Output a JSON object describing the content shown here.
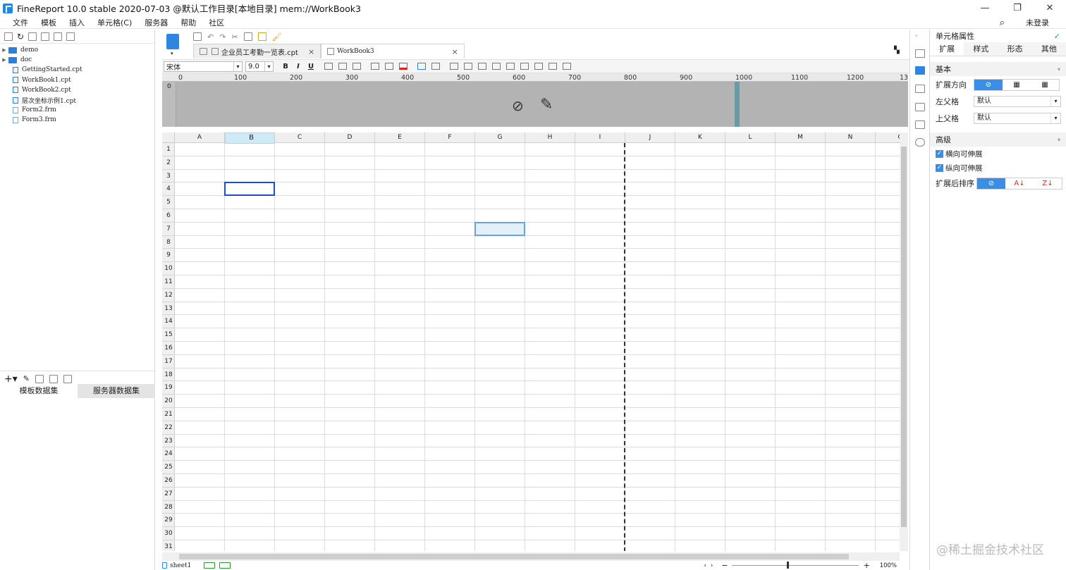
{
  "window": {
    "title": "FineReport 10.0 stable 2020-07-03 @默认工作目录[本地目录]    mem://WorkBook3",
    "minimize_icon": "minimize-icon",
    "restore_icon": "restore-icon",
    "close_icon": "close-icon"
  },
  "menu": {
    "items": [
      "文件",
      "模板",
      "插入",
      "单元格(C)",
      "服务器",
      "帮助",
      "社区"
    ],
    "login": "未登录"
  },
  "tree": {
    "items": [
      {
        "name": "demo",
        "type": "folder"
      },
      {
        "name": "doc",
        "type": "folder"
      },
      {
        "name": "GettingStarted.cpt",
        "type": "cpt"
      },
      {
        "name": "WorkBook1.cpt",
        "type": "cpt"
      },
      {
        "name": "WorkBook2.cpt",
        "type": "cpt"
      },
      {
        "name": "层次坐标示例1.cpt",
        "type": "cpt"
      },
      {
        "name": "Form2.frm",
        "type": "frm"
      },
      {
        "name": "Form3.frm",
        "type": "frm"
      }
    ]
  },
  "datasets": {
    "tab_template": "模板数据集",
    "tab_server": "服务器数据集"
  },
  "tabs": [
    {
      "label": "企业员工考勤一览表.cpt",
      "close": "×"
    },
    {
      "label": "WorkBook3",
      "close": "×"
    }
  ],
  "format": {
    "font": "宋体",
    "size": "9.0",
    "bold": "B",
    "italic": "I",
    "underline": "U"
  },
  "ruler": {
    "labels": [
      "0",
      "100",
      "200",
      "300",
      "400",
      "500",
      "600",
      "700",
      "800",
      "900",
      "1000",
      "1100",
      "1200",
      "13"
    ]
  },
  "grid": {
    "columns": [
      "A",
      "B",
      "C",
      "D",
      "E",
      "F",
      "G",
      "H",
      "I",
      "J",
      "K",
      "L",
      "M",
      "N",
      "O"
    ],
    "rows": [
      "1",
      "2",
      "3",
      "4",
      "5",
      "6",
      "7",
      "8",
      "9",
      "10",
      "11",
      "12",
      "13",
      "14",
      "15",
      "16",
      "17",
      "18",
      "19",
      "20",
      "21",
      "22",
      "23",
      "24",
      "25",
      "26",
      "27",
      "28",
      "29",
      "30",
      "31"
    ],
    "selected_column": "B"
  },
  "status": {
    "sheet": "sheet1",
    "zoom": "100%",
    "minus": "−",
    "plus": "+"
  },
  "props": {
    "title": "单元格属性",
    "tabs": [
      "扩展",
      "样式",
      "形态",
      "其他"
    ],
    "basic": "基本",
    "expand_direction": "扩展方向",
    "left_parent": "左父格",
    "left_parent_value": "默认",
    "top_parent": "上父格",
    "top_parent_value": "默认",
    "advanced": "高级",
    "h_expand": "横向可伸展",
    "v_expand": "纵向可伸展",
    "sort_after": "扩展后排序"
  },
  "watermark": "@稀土掘金技术社区"
}
